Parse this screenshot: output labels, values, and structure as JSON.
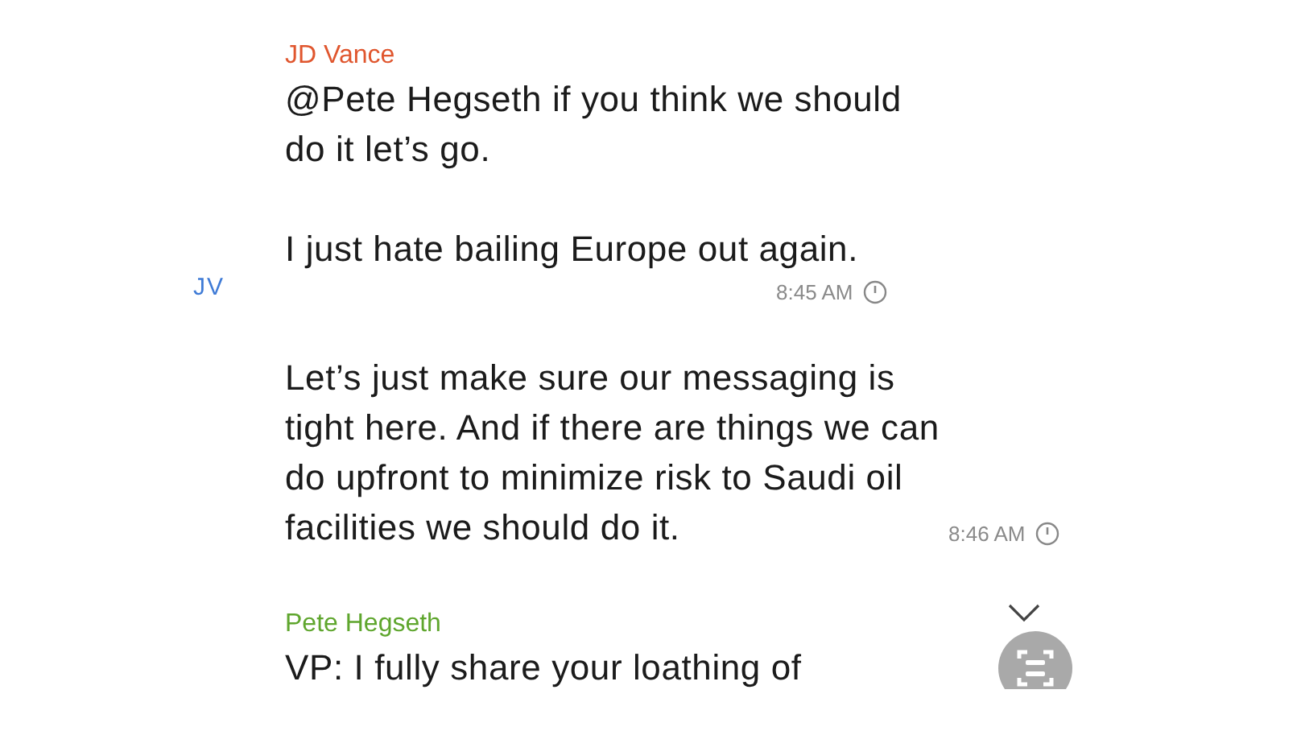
{
  "messages": [
    {
      "sender": "JD Vance",
      "color": "#e0562e",
      "initials": "JV",
      "body": "@Pete Hegseth if you think we should do it let’s go.\n\nI just hate bailing Europe out again.",
      "time": "8:45 AM",
      "kind": "stacked"
    },
    {
      "body": "Let’s just make sure our messaging is tight here. And if there are things we can do upfront to minimize risk to Saudi oil facilities we should do it.",
      "time": "8:46 AM",
      "kind": "inline"
    },
    {
      "sender": "Pete Hegseth",
      "color": "#5fa62e",
      "body": "VP: I fully share your loathing of",
      "kind": "stacked"
    }
  ]
}
